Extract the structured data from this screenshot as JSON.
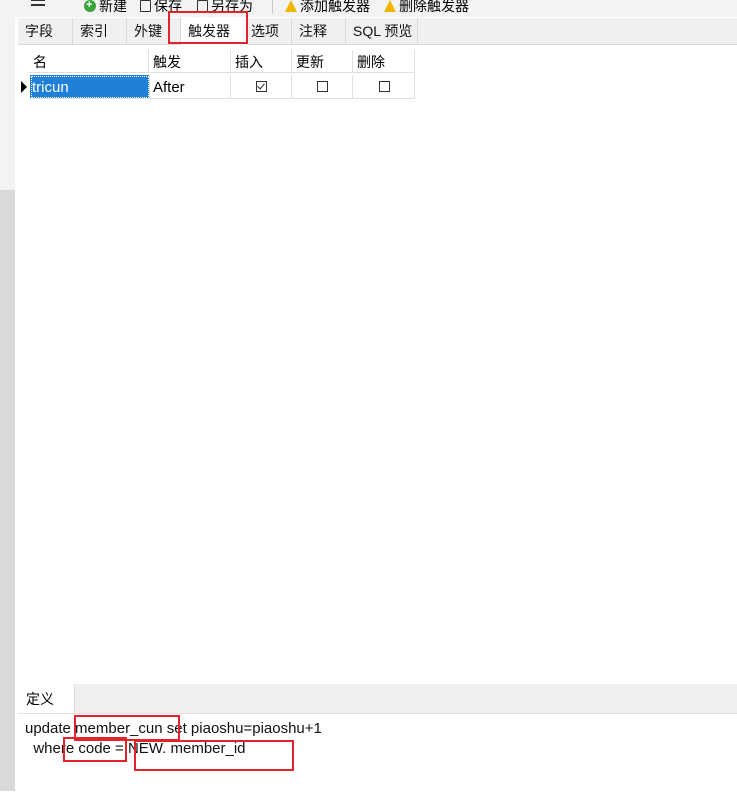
{
  "toolbar": {
    "new_label": "新建",
    "save_label": "保存",
    "save_as_label": "另存为",
    "add_trigger_label": "添加触发器",
    "delete_trigger_label": "删除触发器"
  },
  "tabs": [
    "字段",
    "索引",
    "外键",
    "触发器",
    "选项",
    "注释",
    "SQL 预览"
  ],
  "active_tab": "触发器",
  "grid": {
    "columns": [
      "名",
      "触发",
      "插入",
      "更新",
      "删除"
    ],
    "rows": [
      {
        "name": "tricun",
        "fire": "After",
        "insert": true,
        "update": false,
        "delete": false
      }
    ]
  },
  "definition": {
    "tab_label": "定义",
    "lines": [
      "update member_cun set piaoshu=piaoshu+1",
      "  where code = NEW. member_id"
    ]
  },
  "colors": {
    "selection": "#1f80d8",
    "highlight": "#e3232a"
  }
}
